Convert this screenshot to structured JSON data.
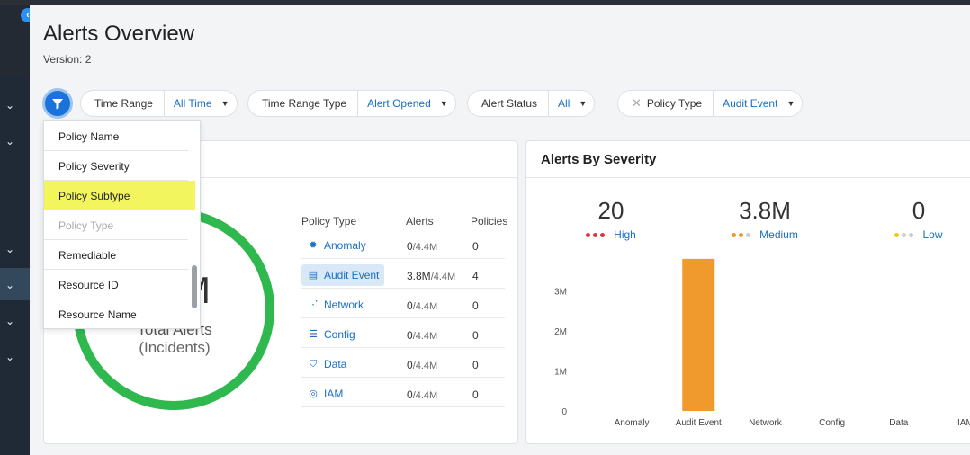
{
  "header": {
    "title": "Alerts Overview",
    "version": "Version: 2"
  },
  "filters": [
    {
      "label": "Time Range",
      "value": "All Time"
    },
    {
      "label": "Time Range Type",
      "value": "Alert Opened"
    },
    {
      "label": "Alert Status",
      "value": "All"
    },
    {
      "label": "Policy Type",
      "value": "Audit Event"
    }
  ],
  "dropdown": {
    "items": [
      "Policy Name",
      "Policy Severity",
      "Policy Subtype",
      "Policy Type",
      "Remediable",
      "Resource ID",
      "Resource Name"
    ],
    "highlighted": "Policy Subtype",
    "disabled": "Policy Type"
  },
  "left_card": {
    "total_number": "M",
    "total_label": "Total Alerts",
    "total_sublabel": "(Incidents)",
    "columns": [
      "Policy Type",
      "Alerts",
      "Policies"
    ],
    "rows": [
      {
        "icon": "anomaly-icon",
        "type": "Anomaly",
        "alerts": "0",
        "of": "/4.4M",
        "policies": "0"
      },
      {
        "icon": "audit-event-icon",
        "type": "Audit Event",
        "alerts": "3.8M",
        "of": "/4.4M",
        "policies": "4",
        "selected": true
      },
      {
        "icon": "network-icon",
        "type": "Network",
        "alerts": "0",
        "of": "/4.4M",
        "policies": "0"
      },
      {
        "icon": "config-icon",
        "type": "Config",
        "alerts": "0",
        "of": "/4.4M",
        "policies": "0"
      },
      {
        "icon": "data-icon",
        "type": "Data",
        "alerts": "0",
        "of": "/4.4M",
        "policies": "0"
      },
      {
        "icon": "iam-icon",
        "type": "IAM",
        "alerts": "0",
        "of": "/4.4M",
        "policies": "0"
      }
    ],
    "ring_color": "#2fb84e"
  },
  "right_card": {
    "title": "Alerts By Severity",
    "severity": [
      {
        "count": "20",
        "label": "High",
        "dot_colors": [
          "#d9363e",
          "#d9363e",
          "#d9363e"
        ]
      },
      {
        "count": "3.8M",
        "label": "Medium",
        "dot_colors": [
          "#f0962e",
          "#f0962e",
          "#cccccc"
        ]
      },
      {
        "count": "0",
        "label": "Low",
        "dot_colors": [
          "#f5c518",
          "#cccccc",
          "#cccccc"
        ]
      }
    ]
  },
  "chart_data": {
    "type": "bar",
    "categories": [
      "Anomaly",
      "Audit Event",
      "Network",
      "Config",
      "Data",
      "IAM"
    ],
    "values": [
      0,
      3800000,
      0,
      0,
      0,
      0
    ],
    "yticks": [
      "0",
      "1M",
      "2M",
      "3M"
    ],
    "ylim": [
      0,
      4000000
    ],
    "bar_color": "#f09a2e"
  }
}
